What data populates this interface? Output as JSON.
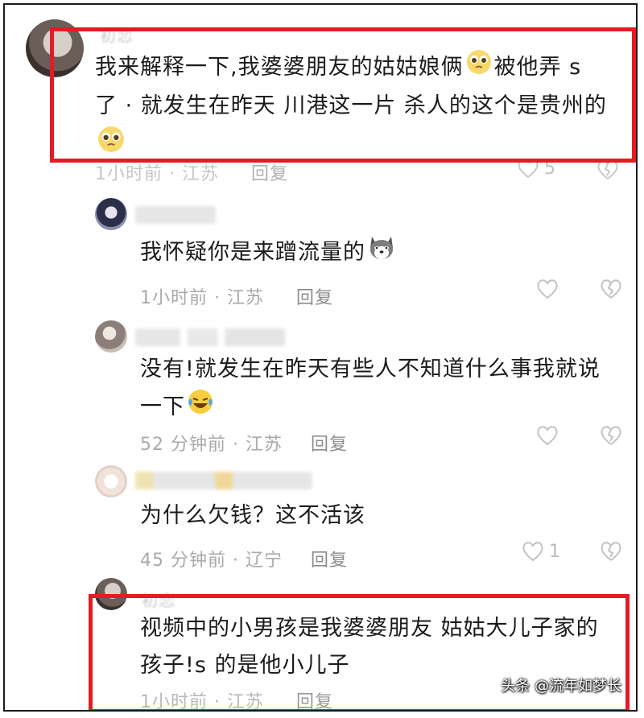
{
  "comments": [
    {
      "name": "初恋",
      "text_line1": "我来解释一下,我婆婆朋友的姑姑娘俩",
      "text_line1b": "被他弄 s",
      "text_line2": "了 · 就发生在昨天 川港这一片 杀人的这个是贵州的",
      "meta": "1小时前 · 江苏",
      "reply_label": "回复",
      "likes": "5"
    },
    {
      "text": "我怀疑你是来蹭流量的",
      "meta": "1小时前 · 江苏",
      "reply_label": "回复"
    },
    {
      "text_line1": "没有!就发生在昨天有些人不知道什么事我就说",
      "text_line2": "一下",
      "meta": "52 分钟前 · 江苏",
      "reply_label": "回复"
    },
    {
      "text": "为什么欠钱？这不活该",
      "meta": "45 分钟前 · 辽宁",
      "reply_label": "回复",
      "likes": "1"
    },
    {
      "name": "初恋",
      "text_line1": "视频中的小男孩是我婆婆朋友 姑姑大儿子家的",
      "text_line2": "孩子!s 的是他小儿子",
      "meta": "1小时前 · 江苏",
      "reply_label": "回复"
    }
  ],
  "watermark": "头条 @流年如梦长",
  "colors": {
    "highlight": "#e41b23",
    "meta": "#a9a9a9"
  }
}
